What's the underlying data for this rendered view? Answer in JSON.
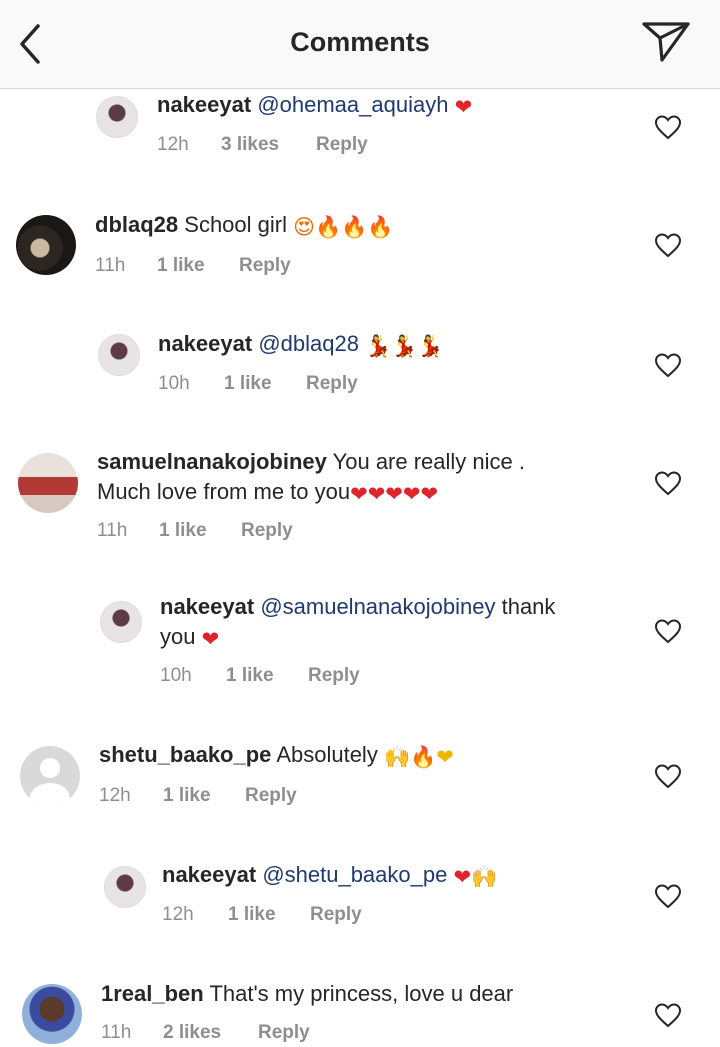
{
  "header": {
    "title": "Comments",
    "back_icon": "chevron-left-icon",
    "send_icon": "paper-plane-icon"
  },
  "comments": [
    {
      "user": "nakeeyat",
      "text": "@ohemaa_aquiayh",
      "emojis": "❤",
      "time": "12h",
      "likes": "3 likes",
      "reply": "Reply",
      "avatar": "nakeeyat-avatar"
    },
    {
      "user": "dblaq28",
      "text": "School girl",
      "emojis": "😍🔥🔥🔥",
      "time": "11h",
      "likes": "1 like",
      "reply": "Reply",
      "avatar": "dblaq28-avatar"
    },
    {
      "user": "nakeeyat",
      "text": "@dblaq28",
      "emojis": "💃💃💃",
      "time": "10h",
      "likes": "1 like",
      "reply": "Reply",
      "avatar": "nakeeyat-avatar"
    },
    {
      "user": "samuelnanakojobiney",
      "text_line1": "You are really nice .",
      "text_line2": "Much love from me to you",
      "emojis": "❤❤❤❤❤",
      "time": "11h",
      "likes": "1 like",
      "reply": "Reply",
      "avatar": "samuel-avatar"
    },
    {
      "user": "nakeeyat",
      "mention": "@samuelnanakojobiney",
      "text_after": "thank",
      "text_line2": "you",
      "emojis": "❤",
      "time": "10h",
      "likes": "1 like",
      "reply": "Reply",
      "avatar": "nakeeyat-avatar"
    },
    {
      "user": "shetu_baako_pe",
      "text": "Absolutely",
      "emojis": "🙌🔥❤",
      "time": "12h",
      "likes": "1 like",
      "reply": "Reply",
      "avatar": "default-avatar"
    },
    {
      "user": "nakeeyat",
      "text": "@shetu_baako_pe",
      "emojis": "❤🙌",
      "time": "12h",
      "likes": "1 like",
      "reply": "Reply",
      "avatar": "nakeeyat-avatar"
    },
    {
      "user": "1real_ben",
      "text": "That's my princess, love u dear",
      "emojis": "",
      "time": "11h",
      "likes": "2 likes",
      "reply": "Reply",
      "avatar": "ben-avatar"
    }
  ],
  "like_icon": "heart-outline-icon"
}
